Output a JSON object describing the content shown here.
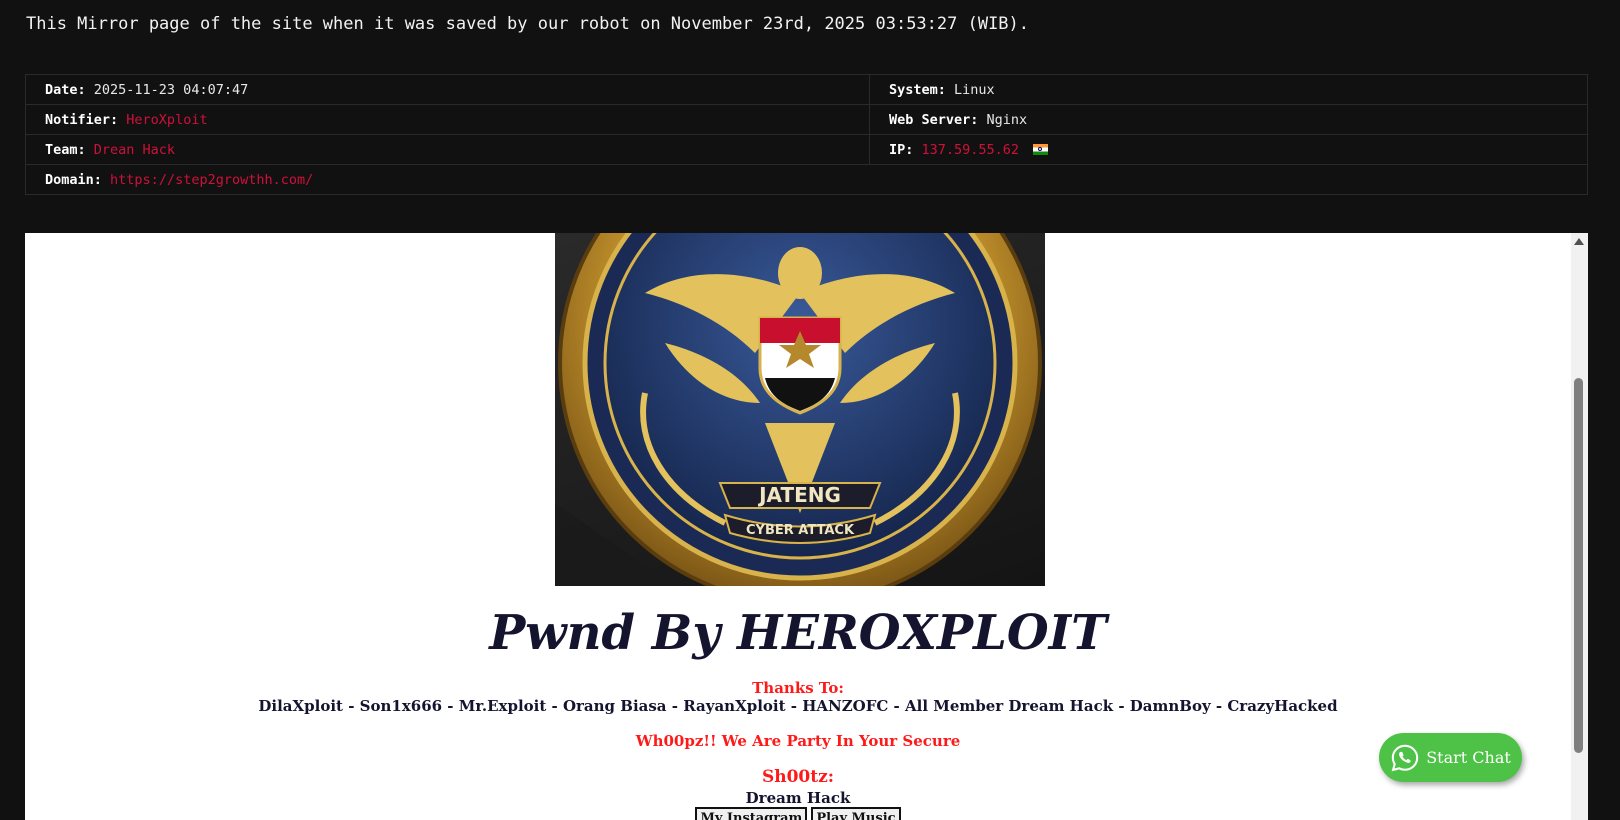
{
  "mirror_note": "This Mirror page of the site when it was saved by our robot on November 23rd, 2025 03:53:27 (WIB).",
  "info": {
    "date_label": "Date:",
    "date_value": "2025-11-23 04:07:47",
    "system_label": "System:",
    "system_value": "Linux",
    "notifier_label": "Notifier:",
    "notifier_value": "HeroXploit",
    "webserver_label": "Web Server:",
    "webserver_value": "Nginx",
    "team_label": "Team:",
    "team_value": "Drean Hack",
    "ip_label": "IP:",
    "ip_value": "137.59.55.62",
    "ip_flag_icon": "india-flag-icon",
    "domain_label": "Domain:",
    "domain_value": "https://step2growthh.com/"
  },
  "mirror_content": {
    "emblem": {
      "top_text": "JATENG",
      "bottom_text": "CYBER ATTACK"
    },
    "title": "Pwnd By HEROXPLOIT",
    "thanks_heading": "Thanks To:",
    "thanks_list": "DilaXploit - Son1x666 - Mr.Exploit - Orang Biasa - RayanXploit - HANZOFC - All Member Dream Hack - DamnBoy - CrazyHacked",
    "tagline": "Wh00pz!! We Are Party In Your Secure",
    "shootz_heading": "Sh00tz:",
    "shootz_team": "Dream Hack",
    "buttons": {
      "instagram": "My Instagram",
      "music": "Play Music"
    }
  },
  "chat": {
    "label": "Start Chat",
    "icon": "whatsapp-icon"
  },
  "colors": {
    "background": "#111111",
    "link_red": "#d0103a",
    "accent_red": "#ff1a1a",
    "title_navy": "#14142e",
    "whatsapp_green": "#4dc247"
  }
}
